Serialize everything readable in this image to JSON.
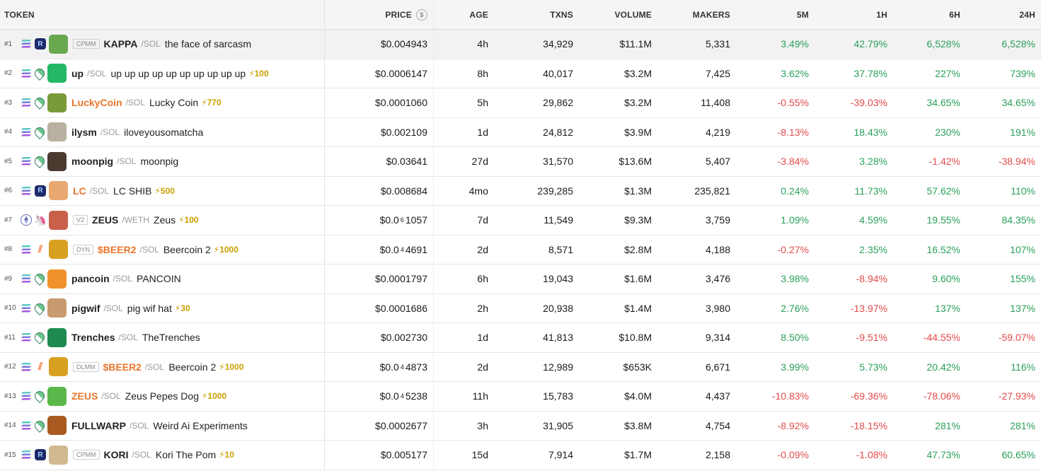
{
  "headers": {
    "token": "TOKEN",
    "price": "PRICE",
    "price_icon": "$",
    "age": "AGE",
    "txns": "TXNS",
    "volume": "VOLUME",
    "makers": "MAKERS",
    "m5": "5M",
    "h1": "1H",
    "h6": "6H",
    "h24": "24H"
  },
  "rows": [
    {
      "rank": "#1",
      "chain": "solana",
      "dex": "raydium",
      "avatar_color": "#6aa84f",
      "badge": "CPMM",
      "symbol": "KAPPA",
      "quote": "/SOL",
      "name": "the face of sarcasm",
      "boost": "",
      "price": "$0.004943",
      "age": "4h",
      "txns": "34,929",
      "volume": "$11.1M",
      "makers": "5,331",
      "m5": "3.49%",
      "h1": "42.79%",
      "h6": "6,528%",
      "h24": "6,528%",
      "selected": true
    },
    {
      "rank": "#2",
      "chain": "solana",
      "dex": "pump",
      "avatar_color": "#22b865",
      "badge": "",
      "symbol": "up",
      "quote": "/SOL",
      "name": "up up up up up up up up up up",
      "boost": "⚡100",
      "price": "$0.0006147",
      "age": "8h",
      "txns": "40,017",
      "volume": "$3.2M",
      "makers": "7,425",
      "m5": "3.62%",
      "h1": "37.78%",
      "h6": "227%",
      "h24": "739%"
    },
    {
      "rank": "#3",
      "chain": "solana",
      "dex": "pump",
      "avatar_color": "#7a9a3a",
      "badge": "",
      "symbol": "LuckyCoin",
      "orange": true,
      "quote": "/SOL",
      "name": "Lucky Coin",
      "boost": "⚡770",
      "price": "$0.0001060",
      "age": "5h",
      "txns": "29,862",
      "volume": "$3.2M",
      "makers": "11,408",
      "m5": "-0.55%",
      "h1": "-39.03%",
      "h6": "34.65%",
      "h24": "34.65%"
    },
    {
      "rank": "#4",
      "chain": "solana",
      "dex": "pump",
      "avatar_color": "#b8b0a0",
      "badge": "",
      "symbol": "ilysm",
      "quote": "/SOL",
      "name": "iloveyousomatcha",
      "boost": "",
      "price": "$0.002109",
      "age": "1d",
      "txns": "24,812",
      "volume": "$3.9M",
      "makers": "4,219",
      "m5": "-8.13%",
      "h1": "18.43%",
      "h6": "230%",
      "h24": "191%"
    },
    {
      "rank": "#5",
      "chain": "solana",
      "dex": "pump",
      "avatar_color": "#4a3a30",
      "badge": "",
      "symbol": "moonpig",
      "quote": "/SOL",
      "name": "moonpig",
      "boost": "",
      "price": "$0.03641",
      "age": "27d",
      "txns": "31,570",
      "volume": "$13.6M",
      "makers": "5,407",
      "m5": "-3.84%",
      "h1": "3.28%",
      "h6": "-1.42%",
      "h24": "-38.94%"
    },
    {
      "rank": "#6",
      "chain": "solana",
      "dex": "raydium",
      "avatar_color": "#e8a870",
      "badge": "",
      "symbol": "LC",
      "orange": true,
      "quote": "/SOL",
      "name": "LC SHIB",
      "boost": "⚡500",
      "price": "$0.008684",
      "age": "4mo",
      "txns": "239,285",
      "volume": "$1.3M",
      "makers": "235,821",
      "m5": "0.24%",
      "h1": "11.73%",
      "h6": "57.62%",
      "h24": "110%"
    },
    {
      "rank": "#7",
      "chain": "ethereum",
      "dex": "uni",
      "avatar_color": "#c8604a",
      "badge": "V2",
      "symbol": "ZEUS",
      "quote": "/WETH",
      "name": "Zeus",
      "boost": "⚡100",
      "price_pre": "$0.0",
      "price_sub": "6",
      "price_post": "1057",
      "age": "7d",
      "txns": "11,549",
      "volume": "$9.3M",
      "makers": "3,759",
      "m5": "1.09%",
      "h1": "4.59%",
      "h6": "19.55%",
      "h24": "84.35%"
    },
    {
      "rank": "#8",
      "chain": "solana",
      "dex": "meteora",
      "avatar_color": "#d8a020",
      "badge": "DYN",
      "symbol": "$BEER2",
      "orange": true,
      "quote": "/SOL",
      "name": "Beercoin 2",
      "boost": "⚡1000",
      "price_pre": "$0.0",
      "price_sub": "4",
      "price_post": "4691",
      "age": "2d",
      "txns": "8,571",
      "volume": "$2.8M",
      "makers": "4,188",
      "m5": "-0.27%",
      "h1": "2.35%",
      "h6": "16.52%",
      "h24": "107%"
    },
    {
      "rank": "#9",
      "chain": "solana",
      "dex": "pump",
      "avatar_color": "#f0922a",
      "badge": "",
      "symbol": "pancoin",
      "quote": "/SOL",
      "name": "PANCOIN",
      "boost": "",
      "price": "$0.0001797",
      "age": "6h",
      "txns": "19,043",
      "volume": "$1.6M",
      "makers": "3,476",
      "m5": "3.98%",
      "h1": "-8.94%",
      "h6": "9.60%",
      "h24": "155%"
    },
    {
      "rank": "#10",
      "chain": "solana",
      "dex": "pump",
      "avatar_color": "#c89a70",
      "badge": "",
      "symbol": "pigwif",
      "quote": "/SOL",
      "name": "pig wif hat",
      "boost": "⚡30",
      "price": "$0.0001686",
      "age": "2h",
      "txns": "20,938",
      "volume": "$1.4M",
      "makers": "3,980",
      "m5": "2.76%",
      "h1": "-13.97%",
      "h6": "137%",
      "h24": "137%"
    },
    {
      "rank": "#11",
      "chain": "solana",
      "dex": "pump",
      "avatar_color": "#1e8a50",
      "badge": "",
      "symbol": "Trenches",
      "quote": "/SOL",
      "name": "TheTrenches",
      "boost": "",
      "price": "$0.002730",
      "age": "1d",
      "txns": "41,813",
      "volume": "$10.8M",
      "makers": "9,314",
      "m5": "8.50%",
      "h1": "-9.51%",
      "h6": "-44.55%",
      "h24": "-59.07%"
    },
    {
      "rank": "#12",
      "chain": "solana",
      "dex": "meteora",
      "avatar_color": "#d8a020",
      "badge": "DLMM",
      "symbol": "$BEER2",
      "orange": true,
      "quote": "/SOL",
      "name": "Beercoin 2",
      "boost": "⚡1000",
      "price_pre": "$0.0",
      "price_sub": "4",
      "price_post": "4873",
      "age": "2d",
      "txns": "12,989",
      "volume": "$653K",
      "makers": "6,671",
      "m5": "3.99%",
      "h1": "5.73%",
      "h6": "20.42%",
      "h24": "116%"
    },
    {
      "rank": "#13",
      "chain": "solana",
      "dex": "pump",
      "avatar_color": "#5ab84a",
      "badge": "",
      "symbol": "ZEUS",
      "orange": true,
      "quote": "/SOL",
      "name": "Zeus Pepes Dog",
      "boost": "⚡1000",
      "price_pre": "$0.0",
      "price_sub": "4",
      "price_post": "5238",
      "age": "11h",
      "txns": "15,783",
      "volume": "$4.0M",
      "makers": "4,437",
      "m5": "-10.83%",
      "h1": "-69.36%",
      "h6": "-78.06%",
      "h24": "-27.93%"
    },
    {
      "rank": "#14",
      "chain": "solana",
      "dex": "pump",
      "avatar_color": "#a85a20",
      "badge": "",
      "symbol": "FULLWARP",
      "quote": "/SOL",
      "name": "Weird Ai Experiments",
      "boost": "",
      "price": "$0.0002677",
      "age": "3h",
      "txns": "31,905",
      "volume": "$3.8M",
      "makers": "4,754",
      "m5": "-8.92%",
      "h1": "-18.15%",
      "h6": "281%",
      "h24": "281%"
    },
    {
      "rank": "#15",
      "chain": "solana",
      "dex": "raydium",
      "avatar_color": "#d0b890",
      "badge": "CPMM",
      "symbol": "KORI",
      "quote": "/SOL",
      "name": "Kori The Pom",
      "boost": "⚡10",
      "price": "$0.005177",
      "age": "15d",
      "txns": "7,914",
      "volume": "$1.7M",
      "makers": "2,158",
      "m5": "-0.09%",
      "h1": "-1.08%",
      "h6": "47.73%",
      "h24": "60.65%"
    }
  ]
}
